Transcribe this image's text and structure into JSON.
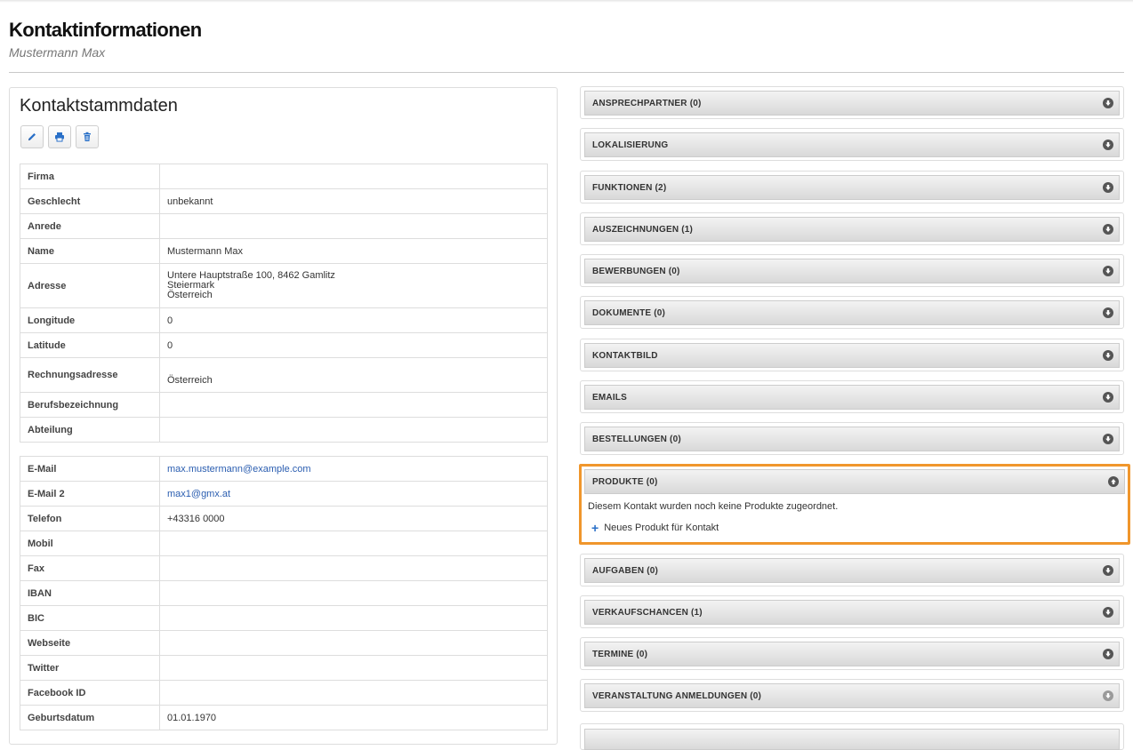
{
  "page": {
    "title": "Kontaktinformationen",
    "subtitle": "Mustermann Max"
  },
  "panel": {
    "heading": "Kontaktstammdaten",
    "toolbar": [
      {
        "name": "edit-button",
        "icon": "pencil-icon"
      },
      {
        "name": "print-button",
        "icon": "printer-icon"
      },
      {
        "name": "delete-button",
        "icon": "trash-icon"
      }
    ]
  },
  "table1": [
    {
      "label": "Firma",
      "value": ""
    },
    {
      "label": "Geschlecht",
      "value": "unbekannt"
    },
    {
      "label": "Anrede",
      "value": ""
    },
    {
      "label": "Name",
      "value": "Mustermann Max"
    },
    {
      "label": "Adresse",
      "value_lines": [
        "Untere Hauptstraße 100, 8462 Gamlitz",
        "Steiermark",
        "Österreich"
      ]
    },
    {
      "label": "Longitude",
      "value": "0"
    },
    {
      "label": "Latitude",
      "value": "0"
    },
    {
      "label": "Rechnungsadresse",
      "value": "Österreich"
    },
    {
      "label": "Berufsbezeichnung",
      "value": ""
    },
    {
      "label": "Abteilung",
      "value": ""
    }
  ],
  "table2": [
    {
      "label": "E-Mail",
      "value": "max.mustermann@example.com",
      "link": true
    },
    {
      "label": "E-Mail 2",
      "value": "max1@gmx.at",
      "link": true
    },
    {
      "label": "Telefon",
      "value": "+43316 0000"
    },
    {
      "label": "Mobil",
      "value": ""
    },
    {
      "label": "Fax",
      "value": ""
    },
    {
      "label": "IBAN",
      "value": ""
    },
    {
      "label": "BIC",
      "value": ""
    },
    {
      "label": "Webseite",
      "value": ""
    },
    {
      "label": "Twitter",
      "value": ""
    },
    {
      "label": "Facebook ID",
      "value": ""
    },
    {
      "label": "Geburtsdatum",
      "value": "01.01.1970"
    }
  ],
  "accordions": [
    {
      "title": "ANSPRECHPARTNER (0)",
      "state": "collapsed"
    },
    {
      "title": "LOKALISIERUNG",
      "state": "collapsed"
    },
    {
      "title": "FUNKTIONEN (2)",
      "state": "collapsed"
    },
    {
      "title": "AUSZEICHNUNGEN (1)",
      "state": "collapsed"
    },
    {
      "title": "BEWERBUNGEN (0)",
      "state": "collapsed"
    },
    {
      "title": "DOKUMENTE (0)",
      "state": "collapsed"
    },
    {
      "title": "KONTAKTBILD",
      "state": "collapsed"
    },
    {
      "title": "EMAILS",
      "state": "collapsed"
    },
    {
      "title": "BESTELLUNGEN (0)",
      "state": "collapsed"
    },
    {
      "title": "PRODUKTE (0)",
      "state": "expanded",
      "empty_message": "Diesem Kontakt wurden noch keine Produkte zugeordnet.",
      "action_label": "Neues Produkt für Kontakt"
    },
    {
      "title": "AUFGABEN (0)",
      "state": "collapsed"
    },
    {
      "title": "VERKAUFSCHANCEN (1)",
      "state": "collapsed"
    },
    {
      "title": "TERMINE (0)",
      "state": "collapsed"
    },
    {
      "title": "VERANSTALTUNG ANMELDUNGEN (0)",
      "state": "collapsed",
      "icon_faded": true
    }
  ],
  "colors": {
    "highlight": "#f0962c",
    "link": "#2a5db0",
    "plus": "#2a70c8"
  }
}
